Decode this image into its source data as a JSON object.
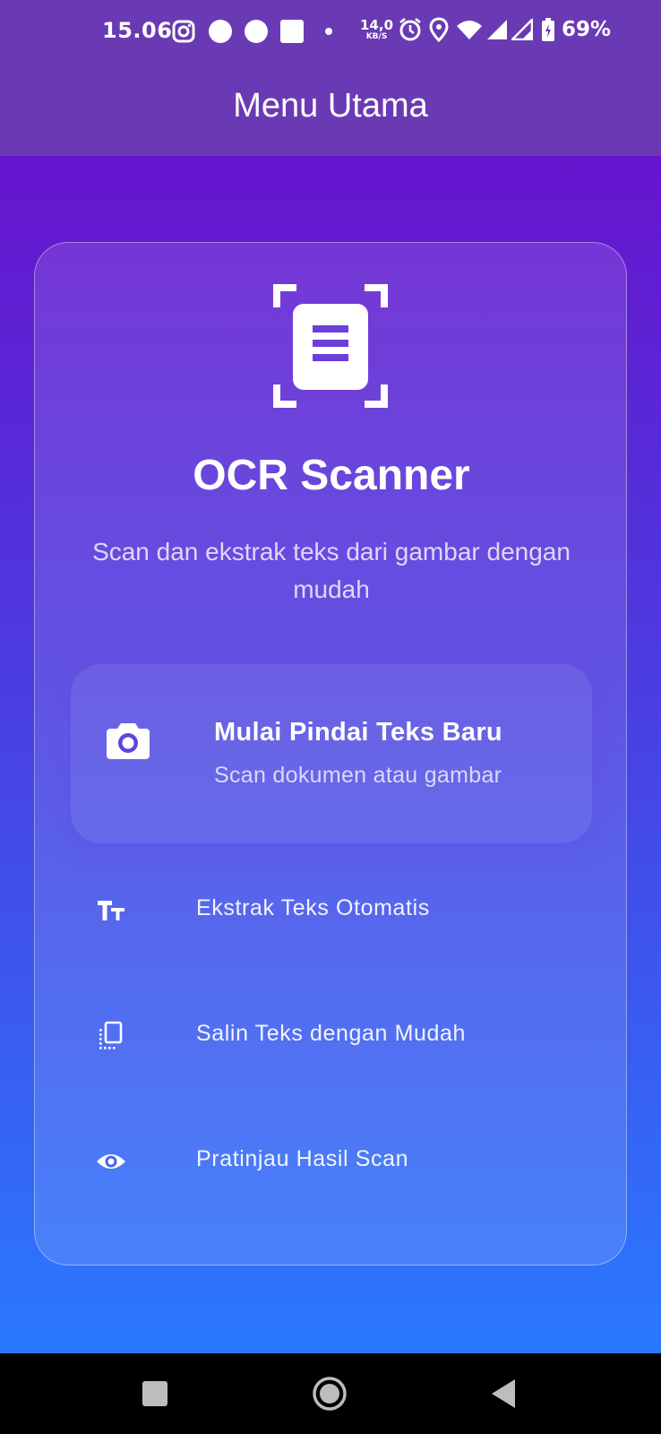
{
  "status_bar": {
    "time": "15.06",
    "net_speed_value": "14,0",
    "net_speed_unit": "KB/S",
    "battery": "69%",
    "icons": [
      "instagram-icon",
      "notification-dot-icon",
      "notification-dot-icon",
      "notification-square-icon",
      "more-dot-icon",
      "alarm-icon",
      "location-icon",
      "wifi-icon",
      "signal-icon",
      "signal-icon",
      "battery-charging-icon"
    ]
  },
  "app_bar": {
    "title": "Menu Utama"
  },
  "card": {
    "logo_icon": "document-scan-icon",
    "app_name": "OCR Scanner",
    "description": "Scan dan ekstrak teks dari gambar dengan mudah",
    "start_scan": {
      "icon": "camera-icon",
      "label": "Mulai Pindai Teks Baru",
      "sublabel": "Scan dokumen atau gambar"
    },
    "features": [
      {
        "icon": "text-fields-icon",
        "label": "Ekstrak Teks Otomatis"
      },
      {
        "icon": "copy-icon",
        "label": "Salin Teks dengan Mudah"
      },
      {
        "icon": "eye-icon",
        "label": "Pratinjau Hasil Scan"
      }
    ]
  },
  "colors": {
    "app_bar": "#6a3ab4",
    "gradient_top": "#6714cd",
    "gradient_bottom": "#2a79ff",
    "text": "#ffffff"
  },
  "nav_bar": {
    "buttons": [
      "recents-button",
      "home-button",
      "back-button"
    ]
  }
}
